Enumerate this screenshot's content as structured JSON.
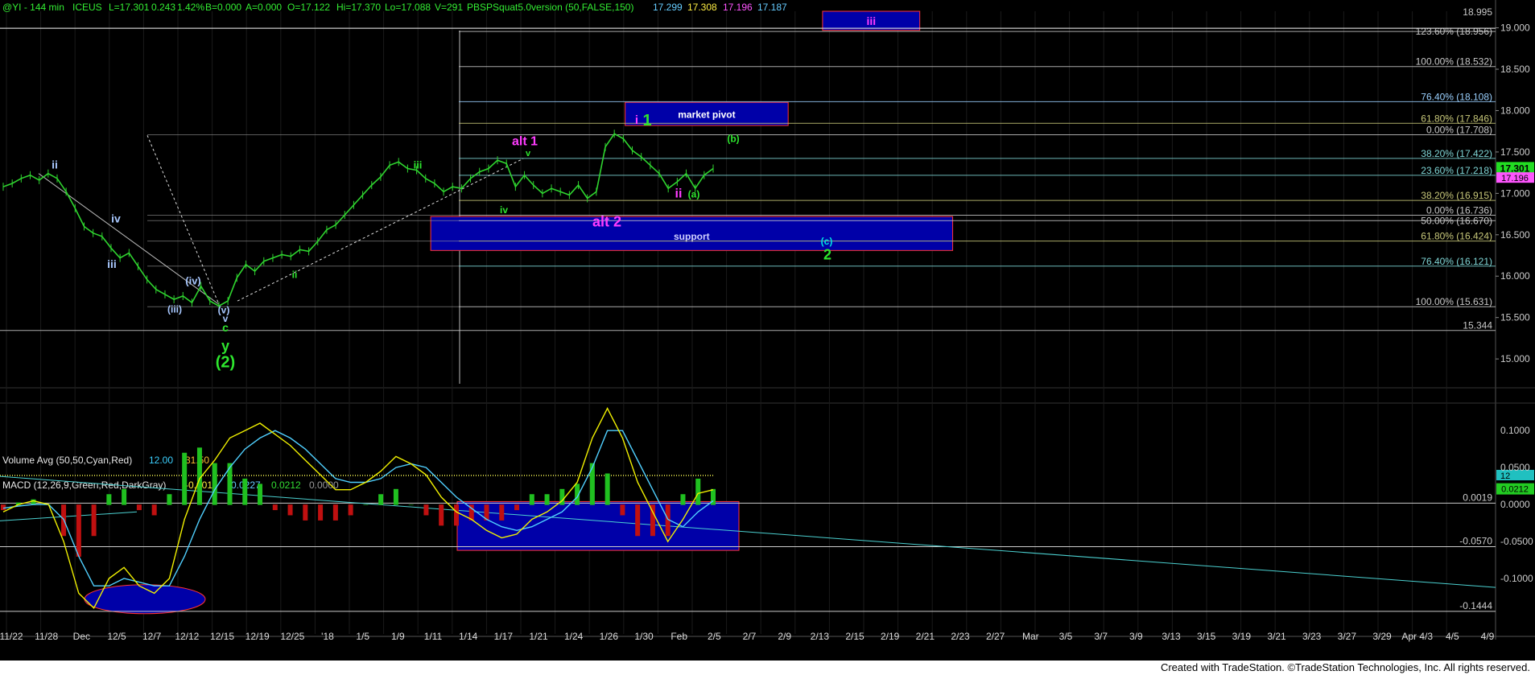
{
  "header": {
    "symbol": "@YI - 144 min",
    "exchange": "ICEUS",
    "last": "L=17.301",
    "change": "0.243",
    "pct": "1.42%",
    "bid": "B=0.000",
    "ask": "A=0.000",
    "open": "O=17.122",
    "high": "Hi=17.370",
    "low": "Lo=17.088",
    "volume": "V=291",
    "study": "PBSPSquat5.0version (50,FALSE,150)",
    "v1": "17.299",
    "v2": "17.308",
    "v3": "17.196",
    "v4": "17.187"
  },
  "footer": "Created with TradeStation. ©TradeStation Technologies, Inc. All rights reserved.",
  "colors": {
    "price": "#2fd42f",
    "level": "#c8c8c8",
    "wave_white": "#a8c8ff",
    "wave_magenta": "#ff3cff",
    "wave_green": "#2ee62e",
    "box_fill": "#0000a8",
    "box_border": "#ff3333",
    "macd": "#f0f000",
    "signal": "#50d0ff",
    "hist_pos": "#20c020",
    "hist_neg": "#c01010"
  },
  "chart_data": {
    "type": "line",
    "price_axis": {
      "ticks": [
        "19.000",
        "18.500",
        "18.000",
        "17.500",
        "17.000",
        "16.500",
        "16.000",
        "15.500",
        "15.000"
      ],
      "ylim": [
        14.7,
        19.2
      ],
      "last_label": "17.301",
      "second_label": "17.196"
    },
    "x_labels": [
      "11/22",
      "11/28",
      "Dec",
      "12/5",
      "12/7",
      "12/12",
      "12/15",
      "12/19",
      "12/25",
      "'18",
      "1/5",
      "1/9",
      "1/11",
      "1/14",
      "1/17",
      "1/21",
      "1/24",
      "1/26",
      "1/30",
      "Feb",
      "2/5",
      "2/7",
      "2/9",
      "2/13",
      "2/15",
      "2/19",
      "2/21",
      "2/23",
      "2/27",
      "Mar",
      "3/5",
      "3/7",
      "3/9",
      "3/13",
      "3/15",
      "3/19",
      "3/21",
      "3/23",
      "3/27",
      "3/29",
      "Apr 4/3",
      "4/5",
      "4/9"
    ],
    "series": [
      {
        "values": [
          17.08,
          17.12,
          17.18,
          17.22,
          17.16,
          17.24,
          17.18,
          17.02,
          16.82,
          16.6,
          16.52,
          16.48,
          16.34,
          16.22,
          16.28,
          16.12,
          15.96,
          15.84,
          15.78,
          15.72,
          15.76,
          15.68,
          15.88,
          15.7,
          15.64,
          15.7,
          15.98,
          16.14,
          16.06,
          16.18,
          16.22,
          16.26,
          16.24,
          16.32,
          16.3,
          16.42,
          16.56,
          16.62,
          16.74,
          16.86,
          16.98,
          17.1,
          17.2,
          17.34,
          17.38,
          17.3,
          17.28,
          17.18,
          17.12,
          17.02,
          17.08,
          17.06,
          17.18,
          17.26,
          17.3,
          17.4,
          17.36,
          17.08,
          17.22,
          17.1,
          17.0,
          17.06,
          17.02,
          16.98,
          17.1,
          16.94,
          17.02,
          17.56,
          17.72,
          17.66,
          17.52,
          17.44,
          17.34,
          17.24,
          17.06,
          17.14,
          17.24,
          17.06,
          17.22,
          17.3
        ]
      }
    ],
    "fib_levels": [
      {
        "label": "123.60% (18.956)",
        "price": 18.956,
        "color": "#c8c8c8"
      },
      {
        "label": "18.995",
        "price": 18.995,
        "color": "#c8c8c8"
      },
      {
        "label": "100.00% (18.532)",
        "price": 18.532,
        "color": "#c8c8c8"
      },
      {
        "label": "76.40% (18.108)",
        "price": 18.108,
        "color": "#9ad0ff"
      },
      {
        "label": "61.80% (17.846)",
        "price": 17.846,
        "color": "#c8c87a"
      },
      {
        "label": "0.00% (17.708)",
        "price": 17.708,
        "color": "#c8c8c8"
      },
      {
        "label": "38.20% (17.422)",
        "price": 17.422,
        "color": "#7fd6d6"
      },
      {
        "label": "23.60% (17.218)",
        "price": 17.218,
        "color": "#7fd6d6"
      },
      {
        "label": "38.20% (16.915)",
        "price": 16.915,
        "color": "#c8c87a"
      },
      {
        "label": "0.00% (16.736)",
        "price": 16.736,
        "color": "#c8c8c8"
      },
      {
        "label": "50.00% (16.670)",
        "price": 16.67,
        "color": "#c8c8c8"
      },
      {
        "label": "61.80% (16.424)",
        "price": 16.424,
        "color": "#c8c87a"
      },
      {
        "label": "76.40% (16.121)",
        "price": 16.121,
        "color": "#7fd6d6"
      },
      {
        "label": "100.00% (15.631)",
        "price": 15.631,
        "color": "#c8c8c8"
      },
      {
        "label": "15.344",
        "price": 15.344,
        "color": "#c8c8c8"
      }
    ],
    "boxes": [
      {
        "label": "iii",
        "price_top": 19.2,
        "price_bottom": 18.97,
        "x_from": 0.55,
        "x_to": 0.615
      },
      {
        "label": "market pivot",
        "price_top": 18.1,
        "price_bottom": 17.82,
        "x_from": 0.418,
        "x_to": 0.527
      },
      {
        "label": "support",
        "price_top": 16.72,
        "price_bottom": 16.31,
        "x_from": 0.288,
        "x_to": 0.637
      }
    ],
    "wave_labels": [
      {
        "text": "ii",
        "color": "white"
      },
      {
        "text": "iv",
        "color": "white"
      },
      {
        "text": "iii",
        "color": "white"
      },
      {
        "text": "(iv)",
        "color": "white"
      },
      {
        "text": "(iii)",
        "color": "white"
      },
      {
        "text": "(v)",
        "color": "white"
      },
      {
        "text": "v",
        "color": "white"
      },
      {
        "text": "c",
        "color": "green"
      },
      {
        "text": "y",
        "color": "green"
      },
      {
        "text": "(2)",
        "color": "green"
      },
      {
        "text": "ii",
        "color": "green"
      },
      {
        "text": "iii",
        "color": "green"
      },
      {
        "text": "iv",
        "color": "green"
      },
      {
        "text": "v",
        "color": "green"
      },
      {
        "text": "alt 1",
        "color": "magenta"
      },
      {
        "text": "alt 2",
        "color": "magenta"
      },
      {
        "text": "i",
        "color": "magenta"
      },
      {
        "text": "1",
        "color": "green"
      },
      {
        "text": "(b)",
        "color": "green"
      },
      {
        "text": "ii",
        "color": "magenta"
      },
      {
        "text": "(a)",
        "color": "green"
      },
      {
        "text": "(c)",
        "color": "cyan"
      },
      {
        "text": "2",
        "color": "green"
      }
    ],
    "volume": {
      "title": "Volume Avg (50,50,Cyan,Red)",
      "v1": "12.00",
      "v2": "31.50",
      "axis_label": "12"
    },
    "macd": {
      "title": "MACD (12,26,9,Green,Red,DarkGray)",
      "v1": "-0.0015",
      "v2": "-0.0227",
      "v3": "0.0212",
      "v4": "0.0000",
      "ticks": [
        "0.1000",
        "0.0500",
        "0.0000",
        "-0.0500",
        "-0.1000"
      ],
      "ylim": [
        -0.175,
        0.135
      ],
      "levels": [
        {
          "label": "0.0019",
          "value": 0.0019
        },
        {
          "label": "-0.0570",
          "value": -0.057
        },
        {
          "label": "-0.1444",
          "value": -0.1444
        }
      ],
      "last_label": "0.0212",
      "macd_values": [
        -0.01,
        0.0,
        0.005,
        0.0,
        -0.05,
        -0.12,
        -0.14,
        -0.1,
        -0.085,
        -0.11,
        -0.12,
        -0.1,
        -0.02,
        0.035,
        0.06,
        0.09,
        0.1,
        0.11,
        0.095,
        0.08,
        0.06,
        0.04,
        0.02,
        0.02,
        0.03,
        0.045,
        0.065,
        0.055,
        0.04,
        0.01,
        -0.01,
        -0.02,
        -0.035,
        -0.045,
        -0.04,
        -0.02,
        -0.01,
        0.005,
        0.03,
        0.09,
        0.13,
        0.09,
        0.03,
        -0.01,
        -0.05,
        -0.02,
        0.015,
        0.02
      ],
      "signal_values": [
        -0.005,
        -0.002,
        0.0,
        0.0,
        -0.02,
        -0.07,
        -0.11,
        -0.11,
        -0.1,
        -0.105,
        -0.11,
        -0.11,
        -0.07,
        -0.02,
        0.02,
        0.05,
        0.075,
        0.09,
        0.1,
        0.09,
        0.075,
        0.055,
        0.035,
        0.03,
        0.03,
        0.035,
        0.05,
        0.055,
        0.05,
        0.03,
        0.01,
        -0.005,
        -0.02,
        -0.03,
        -0.035,
        -0.03,
        -0.02,
        -0.01,
        0.01,
        0.05,
        0.1,
        0.1,
        0.06,
        0.02,
        -0.02,
        -0.03,
        -0.01,
        0.005
      ]
    }
  }
}
